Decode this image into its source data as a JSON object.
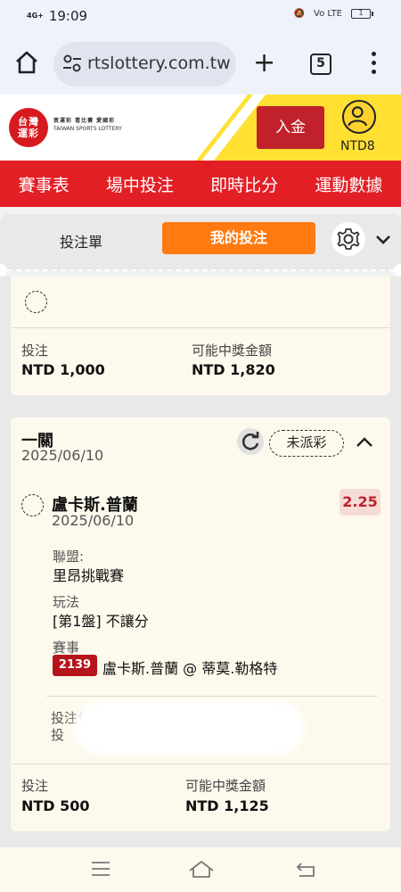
{
  "status_bar": {
    "time": "19:09",
    "network": "4G+",
    "battery": "1"
  },
  "browser": {
    "url": "rtslottery.com.tw",
    "tab_count": "5"
  },
  "header": {
    "logo_line1": "台灣",
    "logo_line2": "運彩",
    "tagline": "買運彩 看比賽 愛國彩",
    "tagline_en": "TAIWAN SPORTS LOTTERY",
    "deposit_label": "入金",
    "balance": "NTD8"
  },
  "nav": {
    "items": [
      "賽事表",
      "場中投注",
      "即時比分",
      "運動數據"
    ]
  },
  "tabs": {
    "slip": "投注單",
    "my_bets": "我的投注"
  },
  "card1": {
    "stake_label": "投注",
    "stake_value": "NTD 1,000",
    "payout_label": "可能中獎金額",
    "payout_value": "NTD 1,820"
  },
  "card2": {
    "bet_type": "一關",
    "bet_date": "2025/06/10",
    "status": "未派彩",
    "selection": {
      "player": "盧卡斯.普蘭",
      "date": "2025/06/10",
      "odds": "2.25",
      "league_label": "聯盟:",
      "league_value": "里昂挑戰賽",
      "market_label": "玩法",
      "market_value": "[第1盤] 不讓分",
      "event_label": "賽事",
      "event_no": "2139",
      "event_name": "盧卡斯.普蘭 @ 蒂莫.勒格特"
    },
    "bet_code_line1": "投注代碼",
    "bet_code_line2": "投",
    "stake_label": "投注",
    "stake_value": "NTD 500",
    "payout_label": "可能中獎金額",
    "payout_value": "NTD 1,125"
  },
  "colors": {
    "brand_red": "#e31f26",
    "accent_orange": "#ff7a10",
    "card_bg": "#fdf9ed",
    "odds_red": "#c0212a"
  }
}
